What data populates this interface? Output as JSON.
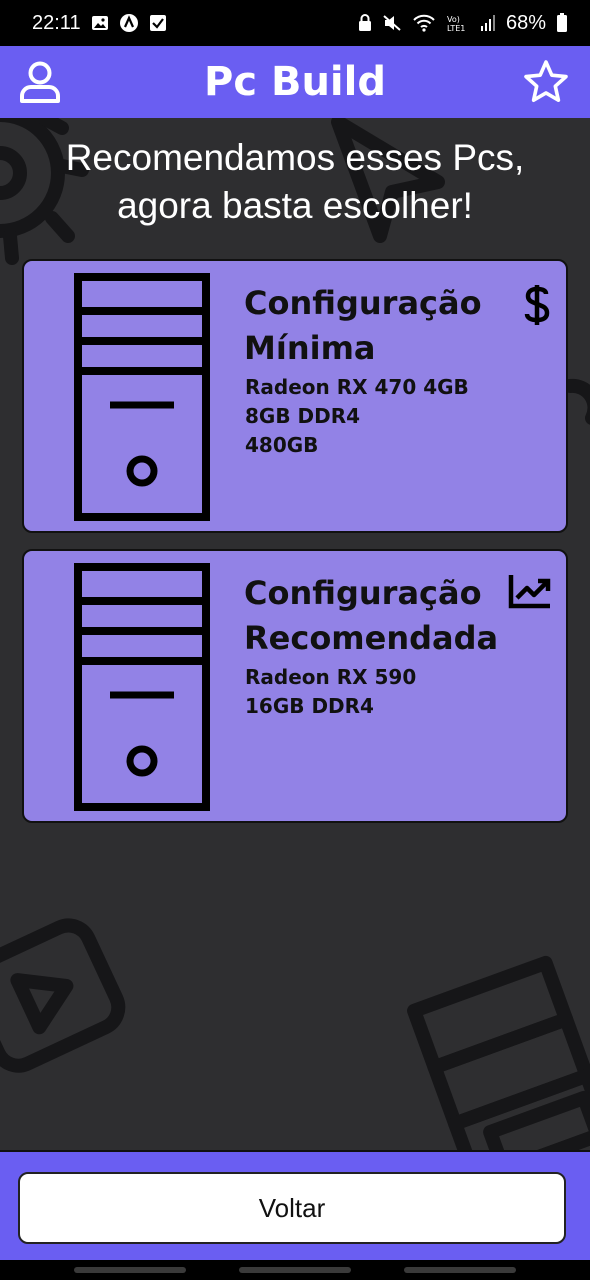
{
  "status_bar": {
    "time": "22:11",
    "battery": "68%"
  },
  "header": {
    "title": "Pc Build",
    "profile_icon": "user-icon",
    "favorite_icon": "star-icon",
    "color": "#6a5ef2"
  },
  "subtitle": "Recomendamos esses Pcs, agora basta escolher!",
  "cards": [
    {
      "title": "Configuração Mínima",
      "specs": [
        "Radeon RX 470 4GB",
        "8GB DDR4",
        "480GB"
      ],
      "icon": "dollar-icon"
    },
    {
      "title": "Configuração Recomendada",
      "specs": [
        "Radeon RX 590",
        "16GB DDR4"
      ],
      "icon": "chart-line-icon"
    }
  ],
  "card_color": "#9282e6",
  "footer": {
    "back_label": "Voltar"
  }
}
